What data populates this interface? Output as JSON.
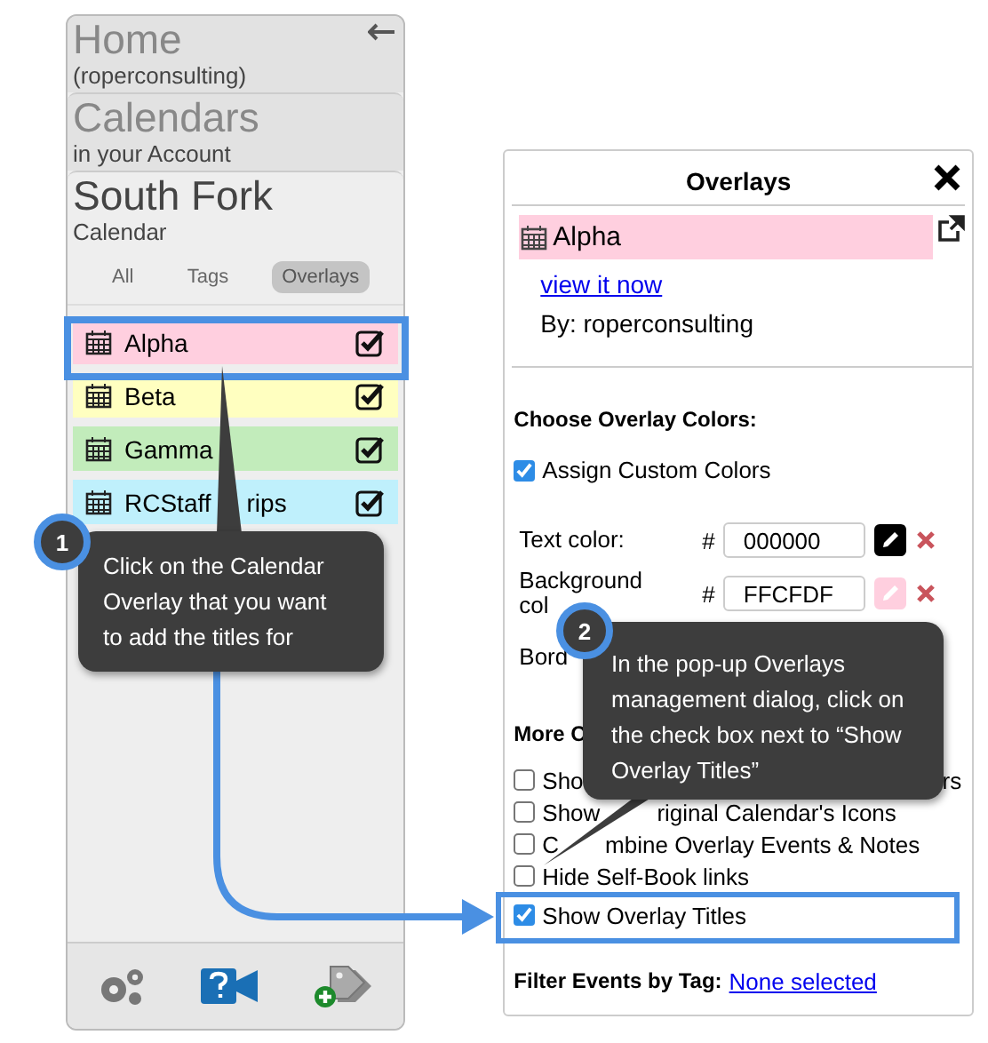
{
  "sidebar": {
    "sections": [
      {
        "title": "Home",
        "subtitle": "(roperconsulting)",
        "selected": false
      },
      {
        "title": "Calendars",
        "subtitle": "in your Account",
        "selected": false
      },
      {
        "title": "South Fork",
        "subtitle": "Calendar",
        "selected": true
      }
    ],
    "tabs": [
      {
        "label": "All",
        "selected": false
      },
      {
        "label": "Tags",
        "selected": false
      },
      {
        "label": "Overlays",
        "selected": true
      }
    ],
    "overlays": [
      {
        "parts": [
          "Alpha"
        ],
        "color": "#ffcfdf",
        "checked": true
      },
      {
        "parts": [
          "Beta"
        ],
        "color": "#ffffc0",
        "checked": true
      },
      {
        "parts": [
          "Gamma"
        ],
        "color": "#c2ecbb",
        "checked": true
      },
      {
        "parts": [
          "RCStaff",
          "rips"
        ],
        "color": "#bff0fc",
        "checked": true
      }
    ]
  },
  "dialog": {
    "title": "Overlays",
    "overlay": {
      "name": "Alpha",
      "color": "#ffcfdf"
    },
    "link": "view it now",
    "owner": "By: roperconsulting",
    "colors_heading": "Choose Overlay Colors:",
    "assign": {
      "label": "Assign Custom Colors",
      "checked": true
    },
    "fields": [
      {
        "label_parts": [
          "Text color:"
        ],
        "hash": "#",
        "value": "000000",
        "color": "#000000"
      },
      {
        "label_parts": [
          "Background",
          "col"
        ],
        "hash": "#",
        "value": "FFCFDF",
        "color": "#ffcfdf"
      },
      {
        "label_parts": [
          "Bord"
        ]
      }
    ],
    "more_heading": "More C",
    "options": [
      {
        "parts": [
          "Sho",
          "rs"
        ],
        "checked": false
      },
      {
        "parts": [
          "Show",
          "riginal Calendar's Icons"
        ],
        "checked": false
      },
      {
        "parts": [
          "C",
          "mbine Overlay Events & Notes"
        ],
        "checked": false
      },
      {
        "parts": [
          "Hide Self-Book links"
        ],
        "checked": false
      },
      {
        "parts": [
          "Show Overlay Titles"
        ],
        "checked": true
      }
    ],
    "filter_label": "Filter Events by Tag:",
    "filter_link": "None selected"
  },
  "callouts": [
    {
      "number": "1",
      "text": "Click on the Calendar Overlay that you want to add the titles for"
    },
    {
      "number": "2",
      "text": "In the pop-up Overlays management dialog, click on the check box next to “Show Overlay Titles”"
    }
  ]
}
